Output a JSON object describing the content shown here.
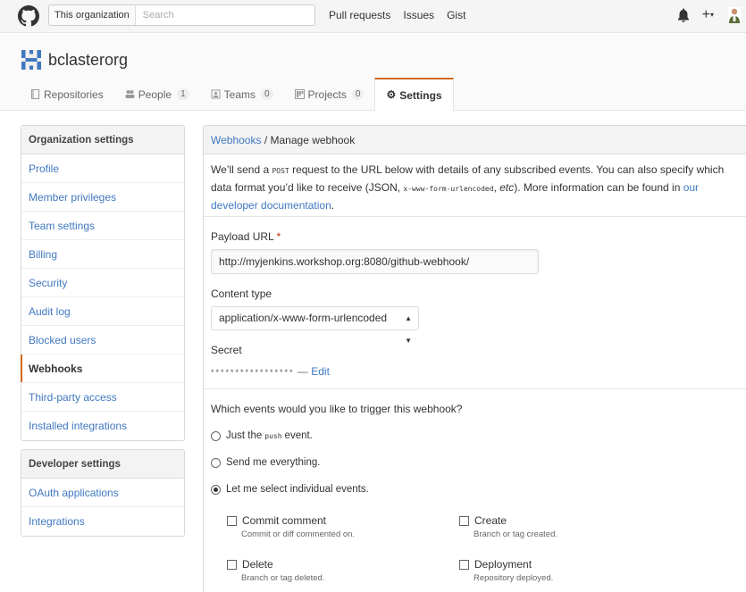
{
  "header": {
    "search_scope": "This organization",
    "search_placeholder": "Search",
    "nav": [
      "Pull requests",
      "Issues",
      "Gist"
    ],
    "plus_label": "+"
  },
  "org": {
    "name": "bclasterorg",
    "tabs": [
      {
        "label": "Repositories",
        "count": "",
        "icon": "repo-icon"
      },
      {
        "label": "People",
        "count": "1",
        "icon": "people-icon"
      },
      {
        "label": "Teams",
        "count": "0",
        "icon": "teams-icon"
      },
      {
        "label": "Projects",
        "count": "0",
        "icon": "projects-icon"
      },
      {
        "label": "Settings",
        "count": "",
        "icon": "gear-icon"
      }
    ],
    "accent": "#d26911"
  },
  "sidebar": {
    "org_settings": {
      "heading": "Organization settings",
      "items": [
        "Profile",
        "Member privileges",
        "Team settings",
        "Billing",
        "Security",
        "Audit log",
        "Blocked users",
        "Webhooks",
        "Third-party access",
        "Installed integrations"
      ]
    },
    "dev_settings": {
      "heading": "Developer settings",
      "items": [
        "OAuth applications",
        "Integrations"
      ]
    }
  },
  "main": {
    "breadcrumb_link": "Webhooks",
    "breadcrumb_sep": " / ",
    "breadcrumb_current": "Manage webhook",
    "intro_1": "We’ll send a ",
    "intro_code_1": "POST",
    "intro_2": " request to the URL below with details of any subscribed events. You can also specify which data format you’d like to receive (JSON, ",
    "intro_code_2": "x-www-form-urlencoded",
    "intro_3": ", ",
    "intro_etc": "etc",
    "intro_4": "). More information can be found in ",
    "intro_link": "our developer documentation",
    "intro_5": ".",
    "payload_label": "Payload URL",
    "required_mark": "*",
    "payload_value": "http://myjenkins.workshop.org:8080/github-webhook/",
    "content_type_label": "Content type",
    "content_type_value": "application/x-www-form-urlencoded",
    "secret_label": "Secret",
    "secret_mask": "*****************",
    "secret_sep": " — ",
    "secret_edit": "Edit",
    "events_question": "Which events would you like to trigger this webhook?",
    "radio_push_1": "Just the",
    "radio_push_code": "push",
    "radio_push_2": "event.",
    "radio_everything": "Send me everything.",
    "radio_individual": "Let me select individual events.",
    "events": [
      {
        "name": "Commit comment",
        "desc": "Commit or diff commented on."
      },
      {
        "name": "Create",
        "desc": "Branch or tag created."
      },
      {
        "name": "Delete",
        "desc": "Branch or tag deleted."
      },
      {
        "name": "Deployment",
        "desc": "Repository deployed."
      }
    ]
  }
}
